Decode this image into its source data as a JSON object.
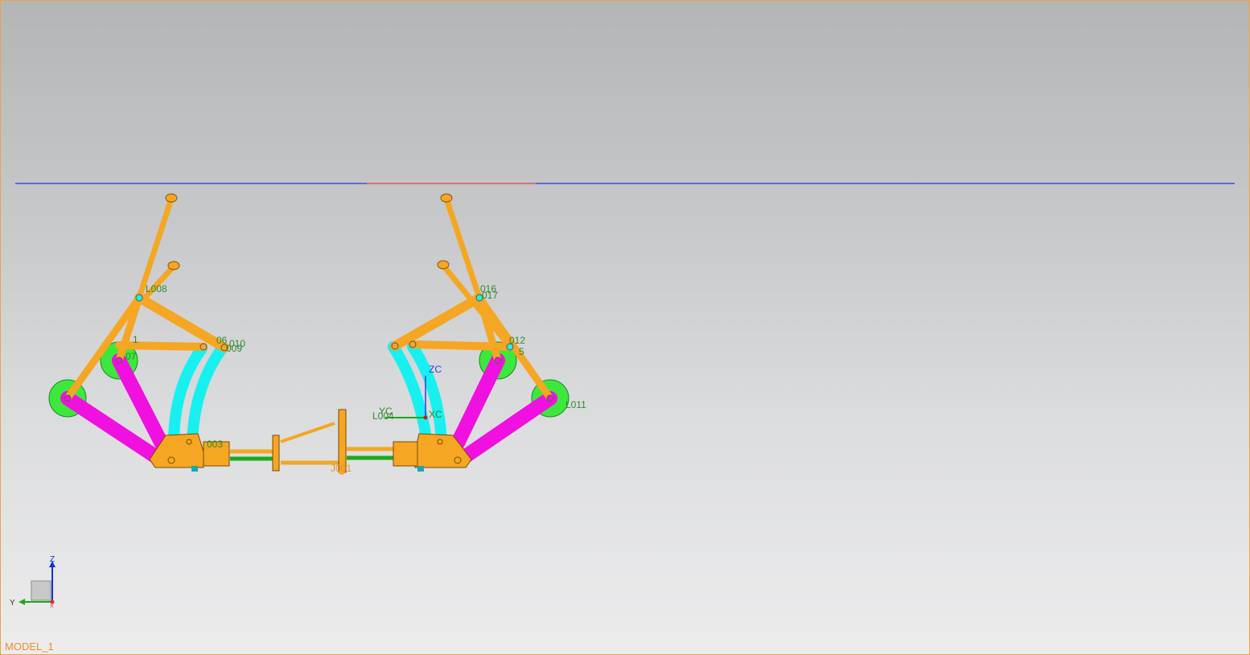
{
  "view": {
    "model_name": "MODEL_1",
    "background_top": "#b4b5b7",
    "background_bottom": "#ececed",
    "border_color": "#f0a040"
  },
  "colors": {
    "link_orange": "#f5a623",
    "link_magenta": "#f010e0",
    "link_cyan": "#18f0f0",
    "wheel_green": "#3ce83c",
    "label_green": "#2e8b2e",
    "ground_blue": "#3a4af0",
    "ground_red": "#e05858"
  },
  "labels": {
    "l008": "L008",
    "l006": "06",
    "l010": "010",
    "l009": "009",
    "l001a": "1",
    "l007": "07",
    "l003": "003",
    "l016": "016",
    "l017": "017",
    "l012": "012",
    "l015": "5",
    "l011": "L011",
    "l004": "L004",
    "zc": "ZC",
    "yc": "YC",
    "xc": "XC",
    "j001": "J001"
  },
  "triad": {
    "z_label": "Z",
    "y_label": "Y",
    "x_label": "X"
  }
}
